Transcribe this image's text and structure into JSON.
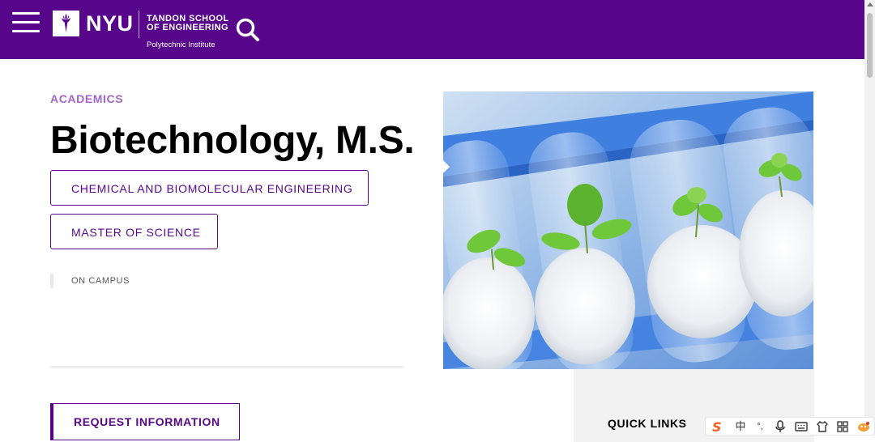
{
  "header": {
    "logo_text": "NYU",
    "school_line1": "TANDON SCHOOL",
    "school_line2": "OF ENGINEERING",
    "subline": "Polytechnic Institute",
    "menu_icon": "hamburger-menu-icon",
    "search_icon": "search-icon",
    "color": "#57068c"
  },
  "main": {
    "eyebrow": "ACADEMICS",
    "title": "Biotechnology, M.S.",
    "department_tag": "CHEMICAL AND BIOMOLECULAR ENGINEERING",
    "degree_tag": "MASTER OF SCIENCE",
    "campus": "ON CAMPUS",
    "cta": "REQUEST INFORMATION"
  },
  "sidebar": {
    "quick_links": "QUICK LINKS"
  },
  "ime": {
    "logo": "S",
    "lang": "中",
    "punct": "°,",
    "icons": [
      "sogou-logo-icon",
      "chinese-mode-icon",
      "punctuation-icon",
      "microphone-icon",
      "keyboard-icon",
      "skin-icon",
      "toolbox-icon",
      "mascot-icon"
    ]
  },
  "colors": {
    "brand": "#57068c",
    "eyebrow": "#a066c8"
  }
}
